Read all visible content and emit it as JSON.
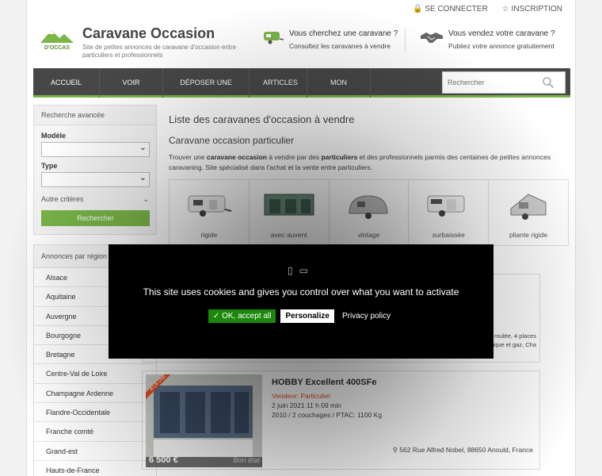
{
  "topbar": {
    "login": "SE CONNECTER",
    "register": "INSCRIPTION"
  },
  "logo": {
    "text": "D'OCCAS"
  },
  "header": {
    "title": "Caravane Occasion",
    "subtitle": "Site de petites annonces de caravane d'occasion entre particuliers et professionnels",
    "promo_buy_title": "Vous cherchez une caravane ?",
    "promo_buy_sub": "Consultez les caravanes à vendre",
    "promo_sell_title": "Vous vendez votre caravane ?",
    "promo_sell_sub": "Publiez votre annonce gratuitement"
  },
  "nav": {
    "items": [
      "ACCUEIL",
      "VOIR TOUT",
      "DÉPOSER UNE ANNONCE",
      "ARTICLES",
      "MON COMPTE"
    ],
    "search_placeholder": "Rechercher"
  },
  "sidebar": {
    "advanced_title": "Recherche avancée",
    "model_label": "Modèle",
    "type_label": "Type",
    "other_criteria": "Autre critères",
    "search_button": "Rechercher",
    "regions_title": "Annonces par région",
    "regions": [
      "Alsace",
      "Aquitaine",
      "Auvergne",
      "Bourgogne",
      "Bretagne",
      "Centre-Val de Loire",
      "Champagne Ardenne",
      "Flandre-Occidentale",
      "Franche comté",
      "Grand-est",
      "Hauts-de-France"
    ]
  },
  "main": {
    "title": "Liste des caravanes d'occasion à vendre",
    "subtitle": "Caravane occasion particulier",
    "intro_1": "Trouver une ",
    "intro_b1": "caravane occasion",
    "intro_2": " à vendre par des ",
    "intro_b2": "particuliers",
    "intro_3": " et des professionnels parmis des centaines de petites annonces caravaning. Site spécialisé dans l'achat et la vente entre particuliers.",
    "types": [
      "rigide",
      "avec auvent",
      "vintage",
      "surbaissée",
      "pliante rigide"
    ]
  },
  "hidden_listing": {
    "text_1": "re peu roulée, 4 places",
    "text_2": "ctrique et gaz, Cha"
  },
  "listing": {
    "ribbon": "A LA UNE",
    "price": "6 500 €",
    "status": "Bon état",
    "title": "HOBBY Excellent 400SFe",
    "seller": "Vendeur: Particulier",
    "date": "2 juin 2021 11 h 09 min",
    "info": "2010 / 2 couchages / PTAC: 1100 Kg",
    "location": "562 Rue Alfred Nobel, 88650 Anould, France"
  },
  "cookie": {
    "message": "This site uses cookies and gives you control over what you want to activate",
    "ok": "✓ OK, accept all",
    "personalize": "Personalize",
    "privacy": "Privacy policy"
  },
  "colors": {
    "accent_green": "#7ab648",
    "nav_bg": "#474747",
    "seller_orange": "#e04a1a",
    "cookie_ok": "#1b870b"
  }
}
